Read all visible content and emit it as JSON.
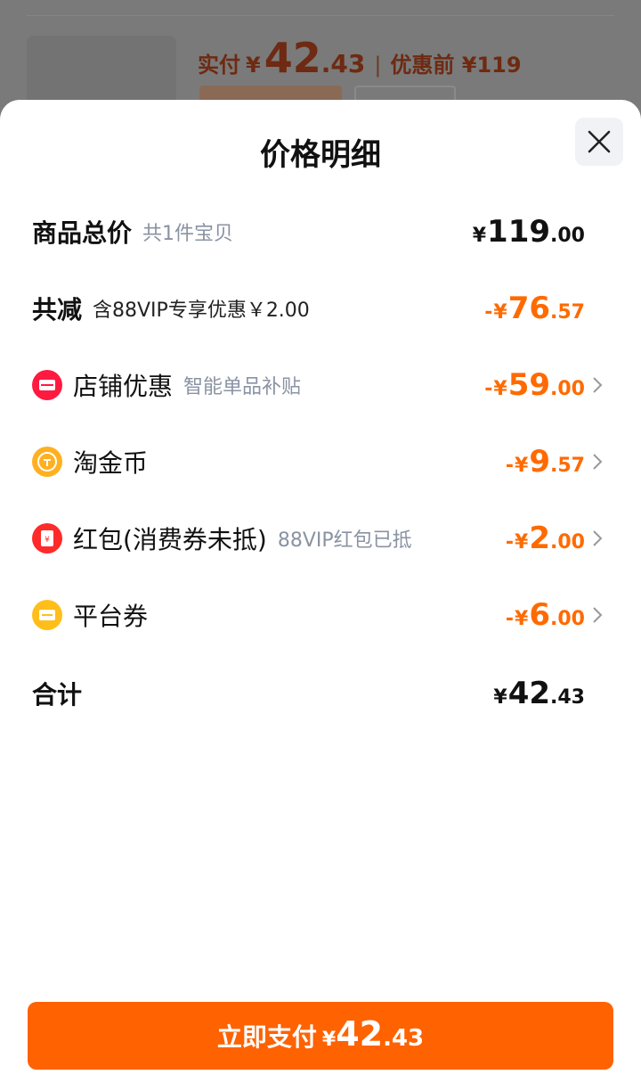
{
  "background": {
    "paid_label": "实付",
    "paid_currency": "¥",
    "paid_int": "42",
    "paid_dec": ".43",
    "separator": "|",
    "orig_label": "优惠前 ¥119"
  },
  "sheet": {
    "title": "价格明细",
    "close_icon": "close-icon"
  },
  "rows": [
    {
      "name": "商品总价",
      "sub": "共1件宝贝",
      "cur": "¥",
      "int": "119",
      "dec": ".00",
      "sign": "",
      "color": "#111111"
    },
    {
      "name": "共减",
      "sub": "含88VIP专享优惠￥2.00",
      "cur": "¥",
      "int": "76",
      "dec": ".57",
      "sign": "-",
      "color": "#ff6a00"
    },
    {
      "name": "店铺优惠",
      "sub": "智能单品补贴",
      "cur": "¥",
      "int": "59",
      "dec": ".00",
      "sign": "-",
      "color": "#ff6a00",
      "icon": "store-coupon-icon",
      "icon_color": "#ff1a40"
    },
    {
      "name": "淘金币",
      "sub": "",
      "cur": "¥",
      "int": "9",
      "dec": ".57",
      "sign": "-",
      "color": "#ff6a00",
      "icon": "coin-icon",
      "icon_color": "#ffb020"
    },
    {
      "name": "红包(消费券未抵)",
      "sub": "88VIP红包已抵",
      "cur": "¥",
      "int": "2",
      "dec": ".00",
      "sign": "-",
      "color": "#ff6a00",
      "icon": "red-packet-icon",
      "icon_color": "#ff2a2a"
    },
    {
      "name": "平台券",
      "sub": "",
      "cur": "¥",
      "int": "6",
      "dec": ".00",
      "sign": "-",
      "color": "#ff6a00",
      "icon": "platform-coupon-icon",
      "icon_color": "#ffbe1a"
    },
    {
      "name": "合计",
      "sub": "",
      "cur": "¥",
      "int": "42",
      "dec": ".43",
      "sign": "",
      "color": "#111111"
    }
  ],
  "pay_button": {
    "label": "立即支付",
    "cur": "¥",
    "int": "42",
    "dec": ".43",
    "color": "#ff6200"
  }
}
